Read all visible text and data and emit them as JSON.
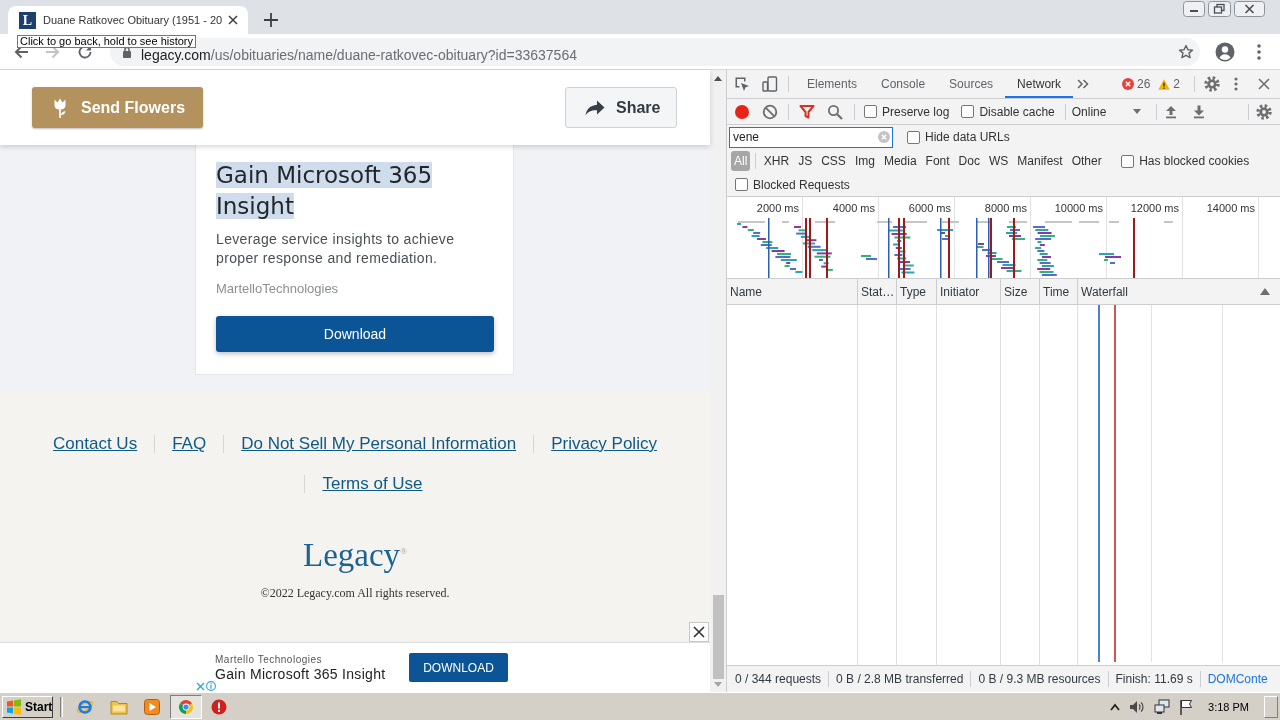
{
  "browser": {
    "tab": {
      "icon_text": "L",
      "title": "Duane Ratkovec Obituary (1951 - 20"
    },
    "address": {
      "host": "legacy.com",
      "path": "/us/obituaries/name/duane-ratkovec-obituary?id=33637564"
    },
    "tooltip": "Click to go back, hold to see history"
  },
  "page": {
    "header_buttons": [
      {
        "kind": "flowers",
        "label": "Send Flowers"
      },
      {
        "kind": "share",
        "label": "Share"
      }
    ],
    "ad_card": {
      "title": "Gain Microsoft 365 Insight",
      "title_selected": true,
      "description": "Leverage service insights to achieve proper response and remediation.",
      "sponsor": "MartelloTechnologies",
      "button": "Download"
    },
    "footer": {
      "links": [
        "Contact Us",
        "FAQ",
        "Do Not Sell My Personal Information",
        "Privacy Policy",
        "Terms of Use"
      ],
      "logo": "Legacy$^{®}$",
      "copyright": "©2022 Legacy.com All rights reserved."
    },
    "sticky_ad": {
      "sponsor": "Martello Technologies",
      "title": "Gain Microsoft 365 Insight",
      "button": "DOWNLOAD"
    }
  },
  "devtools": {
    "tabs": [
      {
        "label": "Elements",
        "selected": false
      },
      {
        "label": "Console",
        "selected": false
      },
      {
        "label": "Sources",
        "selected": false
      },
      {
        "label": "Network",
        "selected": true
      }
    ],
    "errors": "26",
    "warnings": "2",
    "toolbar": {
      "recording": true,
      "filter_active": true,
      "checkboxes": [
        {
          "label": "Preserve log",
          "checked": false
        },
        {
          "label": "Disable cache",
          "checked": false
        }
      ],
      "throttling": "Online"
    },
    "filter": {
      "value": "vene",
      "focused": true,
      "options": [
        {
          "label": "Hide data URLs",
          "checked": false
        }
      ]
    },
    "types": [
      {
        "label": "All",
        "selected": true
      },
      {
        "label": "XHR",
        "selected": false
      },
      {
        "label": "JS",
        "selected": false
      },
      {
        "label": "CSS",
        "selected": false
      },
      {
        "label": "Img",
        "selected": false
      },
      {
        "label": "Media",
        "selected": false
      },
      {
        "label": "Font",
        "selected": false
      },
      {
        "label": "Doc",
        "selected": false
      },
      {
        "label": "WS",
        "selected": false
      },
      {
        "label": "Manifest",
        "selected": false
      },
      {
        "label": "Other",
        "selected": false
      }
    ],
    "type_options": [
      {
        "label": "Has blocked cookies",
        "checked": false
      }
    ],
    "blocked_requests": {
      "label": "Blocked Requests",
      "checked": false
    },
    "overview": {
      "ticks": [
        "2000 ms",
        "4000 ms",
        "6000 ms",
        "8000 ms",
        "10000 ms",
        "12000 ms",
        "14000 ms"
      ]
    },
    "columns": [
      "Name",
      "Stat…",
      "Type",
      "Initiator",
      "Size",
      "Time",
      "Waterfall"
    ],
    "status": [
      {
        "text": "0 / 344 requests",
        "color": "#303942"
      },
      {
        "text": "0 B / 2.8 MB transferred",
        "color": "#303942"
      },
      {
        "text": "0 B / 9.3 MB resources",
        "color": "#303942"
      },
      {
        "text": "Finish: 11.69 s",
        "color": "#303942"
      },
      {
        "text": "DOMConte",
        "color": "#1a73e8"
      }
    ]
  },
  "taskbar": {
    "start": "Start",
    "apps": [
      {
        "kind": "browser",
        "selected": false
      },
      {
        "kind": "folder",
        "selected": false
      },
      {
        "kind": "player",
        "selected": false
      },
      {
        "kind": "round",
        "selected": true
      },
      {
        "kind": "alert",
        "selected": false
      }
    ],
    "clock": "3:18 PM"
  }
}
